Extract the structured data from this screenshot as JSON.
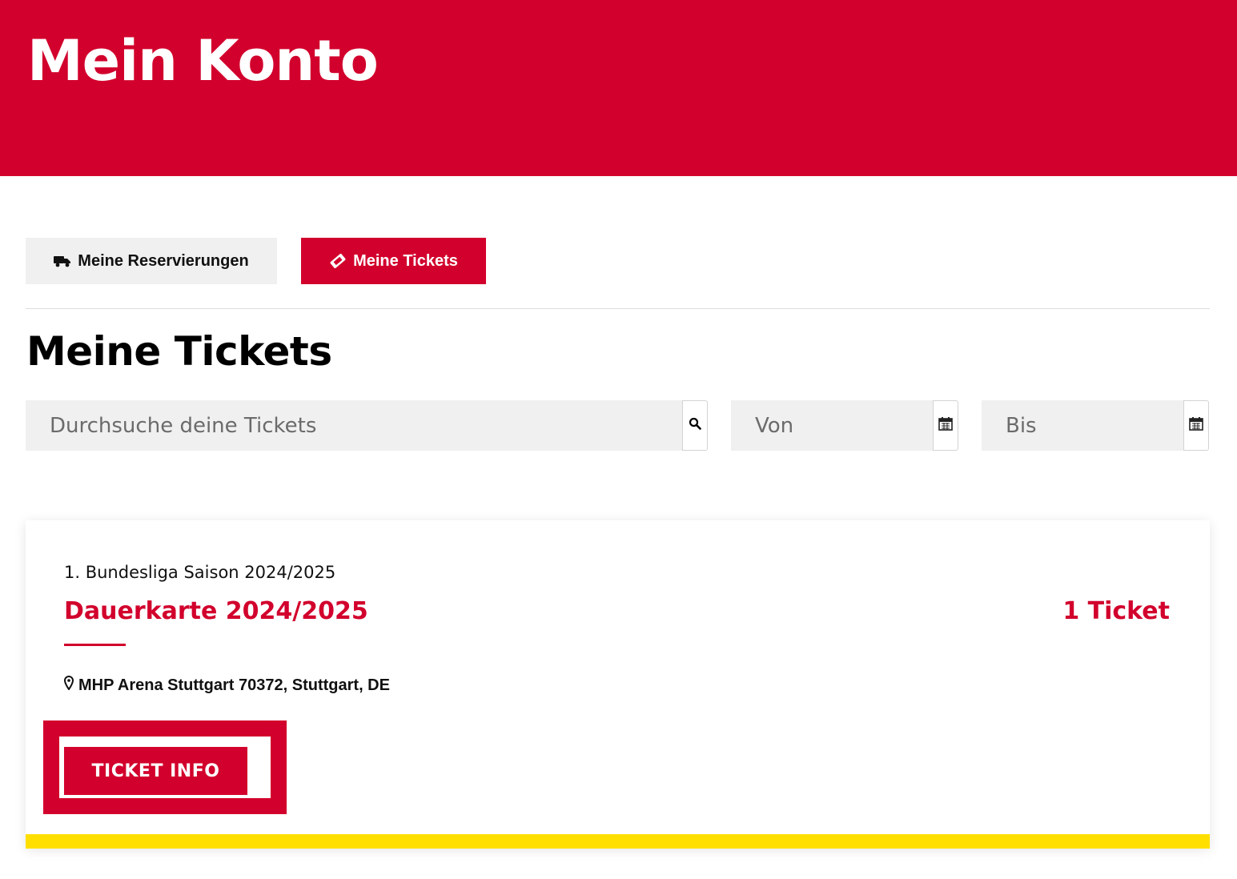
{
  "header": {
    "title": "Mein Konto",
    "background_color": "#d2002c"
  },
  "tabs": [
    {
      "label": "Meine Reservierungen",
      "icon": "truck-icon",
      "active": false
    },
    {
      "label": "Meine Tickets",
      "icon": "ticket-icon",
      "active": true
    }
  ],
  "section": {
    "title": "Meine Tickets"
  },
  "filters": {
    "search_placeholder": "Durchsuche deine Tickets",
    "search_icon": "search-icon",
    "from_placeholder": "Von",
    "to_placeholder": "Bis",
    "calendar_icon": "calendar-icon"
  },
  "ticket_card": {
    "season": "1. Bundesliga Saison 2024/2025",
    "title": "Dauerkarte 2024/2025",
    "count": "1 Ticket",
    "location": "MHP Arena Stuttgart 70372, Stuttgart, DE",
    "location_icon": "map-marker-icon",
    "button_label": "TICKET INFO",
    "accent_color": "#d2002c",
    "bar_color": "#ffdf00"
  }
}
